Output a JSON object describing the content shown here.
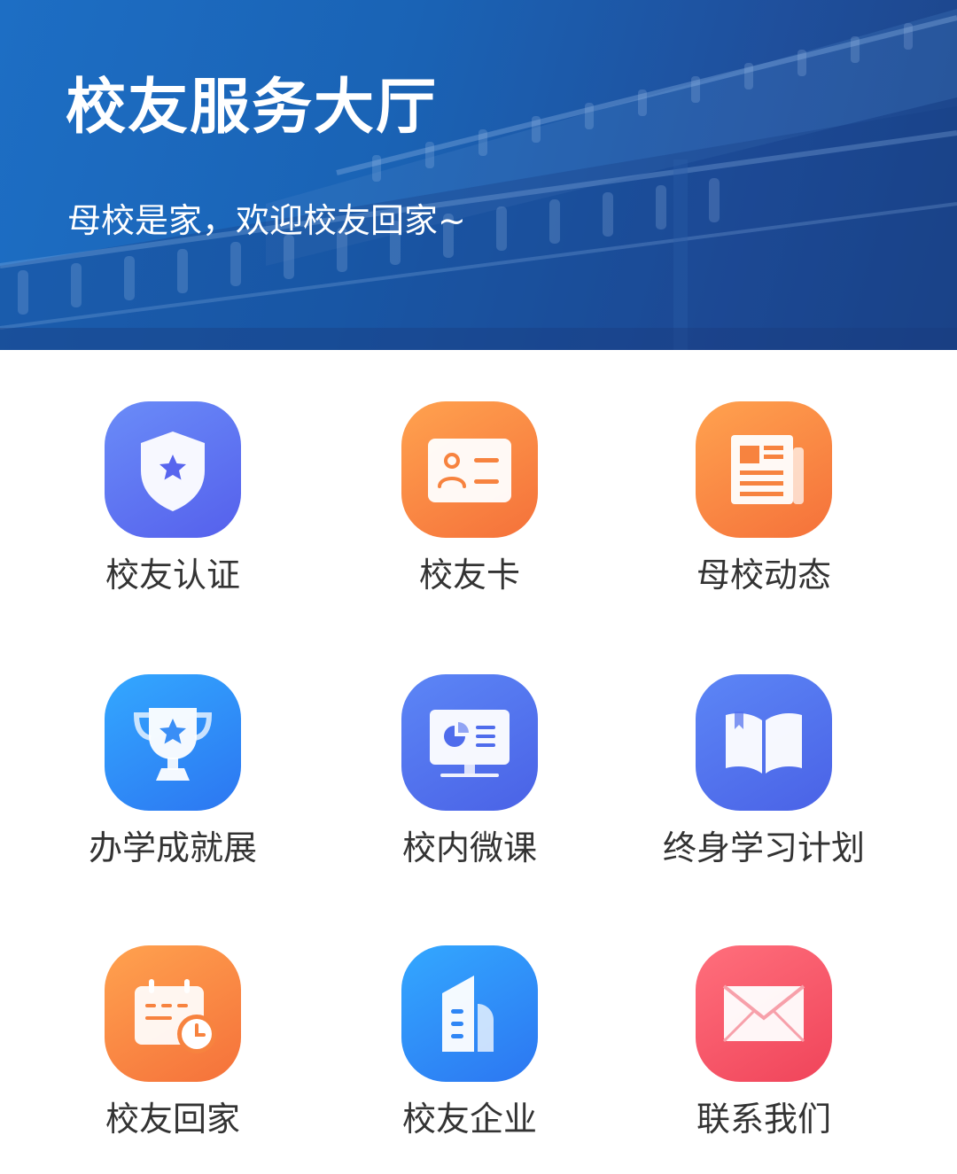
{
  "header": {
    "title": "校友服务大厅",
    "subtitle": "母校是家，欢迎校友回家~"
  },
  "services": [
    {
      "label": "校友认证",
      "icon": "shield-star-icon",
      "color": "#5a6cf0"
    },
    {
      "label": "校友卡",
      "icon": "id-card-icon",
      "color": "#f7833f"
    },
    {
      "label": "母校动态",
      "icon": "newspaper-icon",
      "color": "#f7833f"
    },
    {
      "label": "办学成就展",
      "icon": "trophy-icon",
      "color": "#2f86f5"
    },
    {
      "label": "校内微课",
      "icon": "monitor-chart-icon",
      "color": "#4f6cec"
    },
    {
      "label": "终身学习计划",
      "icon": "open-book-icon",
      "color": "#4f6cec"
    },
    {
      "label": "校友回家",
      "icon": "calendar-clock-icon",
      "color": "#f7833f"
    },
    {
      "label": "校友企业",
      "icon": "building-icon",
      "color": "#2f86f5"
    },
    {
      "label": "联系我们",
      "icon": "envelope-icon",
      "color": "#f24e60"
    }
  ]
}
